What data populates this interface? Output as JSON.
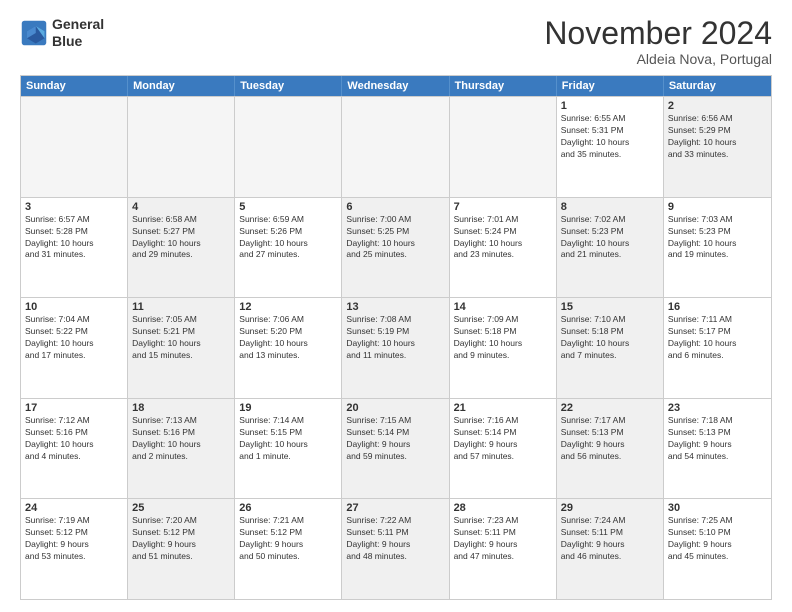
{
  "logo": {
    "line1": "General",
    "line2": "Blue"
  },
  "title": "November 2024",
  "location": "Aldeia Nova, Portugal",
  "days_of_week": [
    "Sunday",
    "Monday",
    "Tuesday",
    "Wednesday",
    "Thursday",
    "Friday",
    "Saturday"
  ],
  "weeks": [
    [
      {
        "day": "",
        "empty": true
      },
      {
        "day": "",
        "empty": true
      },
      {
        "day": "",
        "empty": true
      },
      {
        "day": "",
        "empty": true
      },
      {
        "day": "",
        "empty": true
      },
      {
        "day": "1",
        "info": "Sunrise: 6:55 AM\nSunset: 5:31 PM\nDaylight: 10 hours\nand 35 minutes."
      },
      {
        "day": "2",
        "info": "Sunrise: 6:56 AM\nSunset: 5:29 PM\nDaylight: 10 hours\nand 33 minutes.",
        "shaded": true
      }
    ],
    [
      {
        "day": "3",
        "info": "Sunrise: 6:57 AM\nSunset: 5:28 PM\nDaylight: 10 hours\nand 31 minutes."
      },
      {
        "day": "4",
        "info": "Sunrise: 6:58 AM\nSunset: 5:27 PM\nDaylight: 10 hours\nand 29 minutes.",
        "shaded": true
      },
      {
        "day": "5",
        "info": "Sunrise: 6:59 AM\nSunset: 5:26 PM\nDaylight: 10 hours\nand 27 minutes."
      },
      {
        "day": "6",
        "info": "Sunrise: 7:00 AM\nSunset: 5:25 PM\nDaylight: 10 hours\nand 25 minutes.",
        "shaded": true
      },
      {
        "day": "7",
        "info": "Sunrise: 7:01 AM\nSunset: 5:24 PM\nDaylight: 10 hours\nand 23 minutes."
      },
      {
        "day": "8",
        "info": "Sunrise: 7:02 AM\nSunset: 5:23 PM\nDaylight: 10 hours\nand 21 minutes.",
        "shaded": true
      },
      {
        "day": "9",
        "info": "Sunrise: 7:03 AM\nSunset: 5:23 PM\nDaylight: 10 hours\nand 19 minutes."
      }
    ],
    [
      {
        "day": "10",
        "info": "Sunrise: 7:04 AM\nSunset: 5:22 PM\nDaylight: 10 hours\nand 17 minutes."
      },
      {
        "day": "11",
        "info": "Sunrise: 7:05 AM\nSunset: 5:21 PM\nDaylight: 10 hours\nand 15 minutes.",
        "shaded": true
      },
      {
        "day": "12",
        "info": "Sunrise: 7:06 AM\nSunset: 5:20 PM\nDaylight: 10 hours\nand 13 minutes."
      },
      {
        "day": "13",
        "info": "Sunrise: 7:08 AM\nSunset: 5:19 PM\nDaylight: 10 hours\nand 11 minutes.",
        "shaded": true
      },
      {
        "day": "14",
        "info": "Sunrise: 7:09 AM\nSunset: 5:18 PM\nDaylight: 10 hours\nand 9 minutes."
      },
      {
        "day": "15",
        "info": "Sunrise: 7:10 AM\nSunset: 5:18 PM\nDaylight: 10 hours\nand 7 minutes.",
        "shaded": true
      },
      {
        "day": "16",
        "info": "Sunrise: 7:11 AM\nSunset: 5:17 PM\nDaylight: 10 hours\nand 6 minutes."
      }
    ],
    [
      {
        "day": "17",
        "info": "Sunrise: 7:12 AM\nSunset: 5:16 PM\nDaylight: 10 hours\nand 4 minutes."
      },
      {
        "day": "18",
        "info": "Sunrise: 7:13 AM\nSunset: 5:16 PM\nDaylight: 10 hours\nand 2 minutes.",
        "shaded": true
      },
      {
        "day": "19",
        "info": "Sunrise: 7:14 AM\nSunset: 5:15 PM\nDaylight: 10 hours\nand 1 minute."
      },
      {
        "day": "20",
        "info": "Sunrise: 7:15 AM\nSunset: 5:14 PM\nDaylight: 9 hours\nand 59 minutes.",
        "shaded": true
      },
      {
        "day": "21",
        "info": "Sunrise: 7:16 AM\nSunset: 5:14 PM\nDaylight: 9 hours\nand 57 minutes."
      },
      {
        "day": "22",
        "info": "Sunrise: 7:17 AM\nSunset: 5:13 PM\nDaylight: 9 hours\nand 56 minutes.",
        "shaded": true
      },
      {
        "day": "23",
        "info": "Sunrise: 7:18 AM\nSunset: 5:13 PM\nDaylight: 9 hours\nand 54 minutes."
      }
    ],
    [
      {
        "day": "24",
        "info": "Sunrise: 7:19 AM\nSunset: 5:12 PM\nDaylight: 9 hours\nand 53 minutes."
      },
      {
        "day": "25",
        "info": "Sunrise: 7:20 AM\nSunset: 5:12 PM\nDaylight: 9 hours\nand 51 minutes.",
        "shaded": true
      },
      {
        "day": "26",
        "info": "Sunrise: 7:21 AM\nSunset: 5:12 PM\nDaylight: 9 hours\nand 50 minutes."
      },
      {
        "day": "27",
        "info": "Sunrise: 7:22 AM\nSunset: 5:11 PM\nDaylight: 9 hours\nand 48 minutes.",
        "shaded": true
      },
      {
        "day": "28",
        "info": "Sunrise: 7:23 AM\nSunset: 5:11 PM\nDaylight: 9 hours\nand 47 minutes."
      },
      {
        "day": "29",
        "info": "Sunrise: 7:24 AM\nSunset: 5:11 PM\nDaylight: 9 hours\nand 46 minutes.",
        "shaded": true
      },
      {
        "day": "30",
        "info": "Sunrise: 7:25 AM\nSunset: 5:10 PM\nDaylight: 9 hours\nand 45 minutes."
      }
    ]
  ]
}
